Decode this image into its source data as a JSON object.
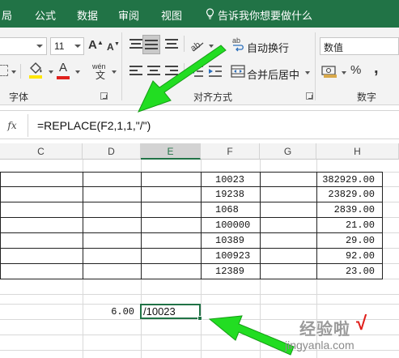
{
  "menu": {
    "items": [
      "局",
      "公式",
      "数据",
      "审阅",
      "视图"
    ],
    "tell_me": "告诉我你想要做什么"
  },
  "ribbon": {
    "font_size": "11",
    "font_group_label": "字体",
    "wrap_text_label": "自动换行",
    "merge_center_label": "合并后居中",
    "alignment_group_label": "对齐方式",
    "number_format": "数值",
    "number_group_label": "数字",
    "percent_symbol": "%",
    "comma_symbol": ",",
    "font_color_letter": "A",
    "grow_font_letter": "A",
    "shrink_font_letter": "A",
    "phonetic_label": "wén"
  },
  "formula_bar": {
    "fx_label": "fx",
    "formula": "=REPLACE(F2,1,1,\"/\")"
  },
  "columns": [
    "C",
    "D",
    "E",
    "F",
    "G",
    "H"
  ],
  "selected_column": "E",
  "table": {
    "f_values": [
      "10023",
      "19238",
      "1068",
      "100000",
      "10389",
      "100923",
      "12389"
    ],
    "h_values": [
      "382929.00",
      "23829.00",
      "2839.00",
      "21.00",
      "29.00",
      "92.00",
      "23.00"
    ]
  },
  "cells": {
    "d_result": "6.00",
    "e_result": "/10023"
  },
  "watermark": {
    "text": "经验啦",
    "check": "√",
    "url": "jingyanla.com"
  },
  "colors": {
    "excel_green": "#217346",
    "arrow_green": "#22dd22",
    "font_color_red": "#e0201c",
    "highlight_yellow": "#ffe600"
  }
}
